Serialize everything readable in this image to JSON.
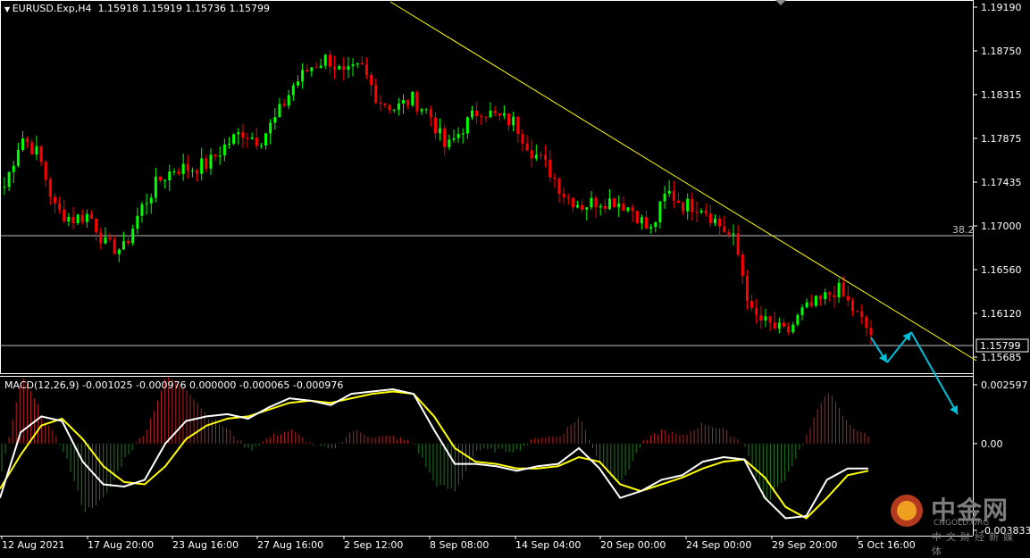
{
  "header": {
    "symbol": "EURUSD.Exp,H4",
    "ohlc": "1.15918 1.15919 1.15736 1.15799"
  },
  "macd_header": "MACD(12,26,9) -0.001025 -0.000976 0.000000 -0.000065 -0.000976",
  "price_axis": {
    "ticks": [
      "1.19190",
      "1.18750",
      "1.18315",
      "1.17875",
      "1.17435",
      "1.17000",
      "1.16560",
      "1.16120",
      "1.15685"
    ],
    "current_price": "1.15799",
    "fib_label": "38.2"
  },
  "macd_axis": {
    "ticks": [
      "0.002597",
      "0.00",
      "-0.003833"
    ]
  },
  "time_axis": {
    "labels": [
      "12 Aug 2021",
      "17 Aug 20:00",
      "23 Aug 16:00",
      "27 Aug 16:00",
      "2 Sep 12:00",
      "8 Sep 08:00",
      "14 Sep 04:00",
      "20 Sep 00:00",
      "24 Sep 00:00",
      "29 Sep 20:00",
      "5 Oct 16:00"
    ]
  },
  "watermark": {
    "name": "中金网",
    "domain": "CNGOLD.ORG",
    "tagline": "中文财经新媒体"
  },
  "colors": {
    "background": "#000000",
    "bull": "#00ff00",
    "bear": "#ff0000",
    "trendline": "#ffff00",
    "horizontal_levels": "#c0c0c0",
    "macd_line": "#ffffff",
    "signal_line": "#ffff00",
    "histogram_positive": "#b22222",
    "histogram_negative": "#1f7a1f",
    "projection_arrows": "#00bfd8"
  },
  "chart_data": [
    {
      "type": "candlestick",
      "symbol": "EURUSD.Exp",
      "timeframe": "H4",
      "ylim": [
        1.1555,
        1.1935
      ],
      "horizontal_levels": [
        {
          "label": "38.2",
          "price": 1.1693
        },
        {
          "label": "",
          "price": 1.158
        }
      ],
      "trendline": {
        "from": {
          "x": "2 Sep 12:00",
          "y": 1.1935
        },
        "to": {
          "x": "11 Oct",
          "y": 1.156
        }
      },
      "close_path": [
        [
          "12 Aug 2021",
          1.174
        ],
        [
          "13 Aug",
          1.1795
        ],
        [
          "16 Aug",
          1.1775
        ],
        [
          "17 Aug",
          1.1715
        ],
        [
          "17 Aug 20:00",
          1.1705
        ],
        [
          "18 Aug",
          1.171
        ],
        [
          "19 Aug",
          1.1675
        ],
        [
          "20 Aug",
          1.1672
        ],
        [
          "23 Aug",
          1.1715
        ],
        [
          "23 Aug 16:00",
          1.1745
        ],
        [
          "24 Aug",
          1.176
        ],
        [
          "25 Aug",
          1.176
        ],
        [
          "26 Aug",
          1.1765
        ],
        [
          "27 Aug",
          1.1785
        ],
        [
          "27 Aug 16:00",
          1.18
        ],
        [
          "30 Aug",
          1.179
        ],
        [
          "31 Aug",
          1.1815
        ],
        [
          "1 Sep",
          1.185
        ],
        [
          "2 Sep",
          1.187
        ],
        [
          "2 Sep 12:00",
          1.188
        ],
        [
          "3 Sep",
          1.186
        ],
        [
          "6 Sep",
          1.187
        ],
        [
          "7 Sep",
          1.1835
        ],
        [
          "8 Sep",
          1.1825
        ],
        [
          "8 Sep 08:00",
          1.1835
        ],
        [
          "9 Sep",
          1.182
        ],
        [
          "10 Sep",
          1.178
        ],
        [
          "13 Sep",
          1.1805
        ],
        [
          "14 Sep",
          1.1825
        ],
        [
          "14 Sep 04:00",
          1.1815
        ],
        [
          "15 Sep",
          1.181
        ],
        [
          "16 Sep",
          1.178
        ],
        [
          "16 Sep 20:00",
          1.176
        ],
        [
          "17 Sep",
          1.173
        ],
        [
          "20 Sep",
          1.172
        ],
        [
          "20 Sep 00:00",
          1.1725
        ],
        [
          "21 Sep",
          1.1725
        ],
        [
          "22 Sep",
          1.1715
        ],
        [
          "22 Sep 20:00",
          1.169
        ],
        [
          "23 Sep",
          1.1735
        ],
        [
          "24 Sep",
          1.172
        ],
        [
          "24 Sep 00:00",
          1.172
        ],
        [
          "27 Sep",
          1.17
        ],
        [
          "28 Sep",
          1.168
        ],
        [
          "29 Sep",
          1.16
        ],
        [
          "29 Sep 20:00",
          1.159
        ],
        [
          "30 Sep",
          1.158
        ],
        [
          "1 Oct",
          1.1605
        ],
        [
          "4 Oct",
          1.1615
        ],
        [
          "5 Oct",
          1.163
        ],
        [
          "5 Oct 16:00",
          1.1605
        ],
        [
          "6 Oct",
          1.158
        ]
      ],
      "projection": [
        {
          "from": 1.158,
          "to": 1.1565
        },
        {
          "from": 1.1565,
          "to": 1.16
        },
        {
          "from": 1.16,
          "to": 1.152
        }
      ]
    },
    {
      "type": "line",
      "title": "MACD(12,26,9)",
      "ylim": [
        -0.003833,
        0.002597
      ],
      "series": [
        {
          "name": "MACD",
          "values": [
            -0.0024,
            0.0005,
            0.0012,
            0.001,
            -0.0008,
            -0.0018,
            -0.0019,
            -0.0016,
            0.0,
            0.001,
            0.0012,
            0.0013,
            0.0011,
            0.0016,
            0.002,
            0.0019,
            0.0017,
            0.0022,
            0.0023,
            0.0024,
            0.0022,
            0.0006,
            -0.0009,
            -0.0009,
            -0.001,
            -0.0012,
            -0.001,
            -0.0009,
            -0.0002,
            -0.0011,
            -0.0024,
            -0.0021,
            -0.0016,
            -0.0014,
            -0.0008,
            -0.0006,
            -0.0007,
            -0.0024,
            -0.0033,
            -0.0032,
            -0.0016,
            -0.0011,
            -0.0011
          ]
        },
        {
          "name": "Signal",
          "values": [
            -0.002,
            -0.0005,
            0.0008,
            0.0011,
            0.0002,
            -0.001,
            -0.0017,
            -0.0018,
            -0.001,
            0.0002,
            0.0008,
            0.0011,
            0.0012,
            0.0015,
            0.0018,
            0.0019,
            0.0018,
            0.002,
            0.0022,
            0.0023,
            0.0022,
            0.0012,
            -0.0002,
            -0.0008,
            -0.0009,
            -0.0011,
            -0.0011,
            -0.001,
            -0.0006,
            -0.0008,
            -0.0018,
            -0.0021,
            -0.0018,
            -0.0015,
            -0.0011,
            -0.0008,
            -0.0007,
            -0.0015,
            -0.0028,
            -0.0033,
            -0.0024,
            -0.0014,
            -0.0012
          ]
        }
      ],
      "histogram_range": [
        -0.0013,
        0.0013
      ]
    }
  ]
}
